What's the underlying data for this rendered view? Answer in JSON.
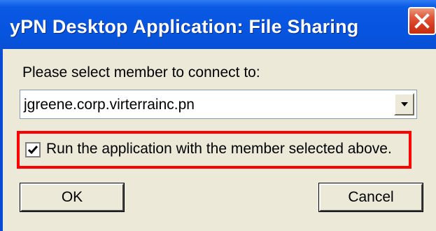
{
  "window": {
    "title": "yPN Desktop Application: File Sharing",
    "close_icon": "close-icon"
  },
  "dialog": {
    "prompt": "Please select member to connect to:",
    "member_select": {
      "selected_value": "jgreene.corp.virterrainc.pn",
      "arrow_icon": "chevron-down-icon"
    },
    "run_checkbox": {
      "checked": true,
      "label": "Run the application with the member selected above."
    },
    "ok_label": "OK",
    "cancel_label": "Cancel"
  },
  "colors": {
    "titlebar": "#0755e0",
    "dialog_background": "#ece9d8",
    "highlight_border": "#ff0000",
    "close_button": "#d6381c"
  }
}
